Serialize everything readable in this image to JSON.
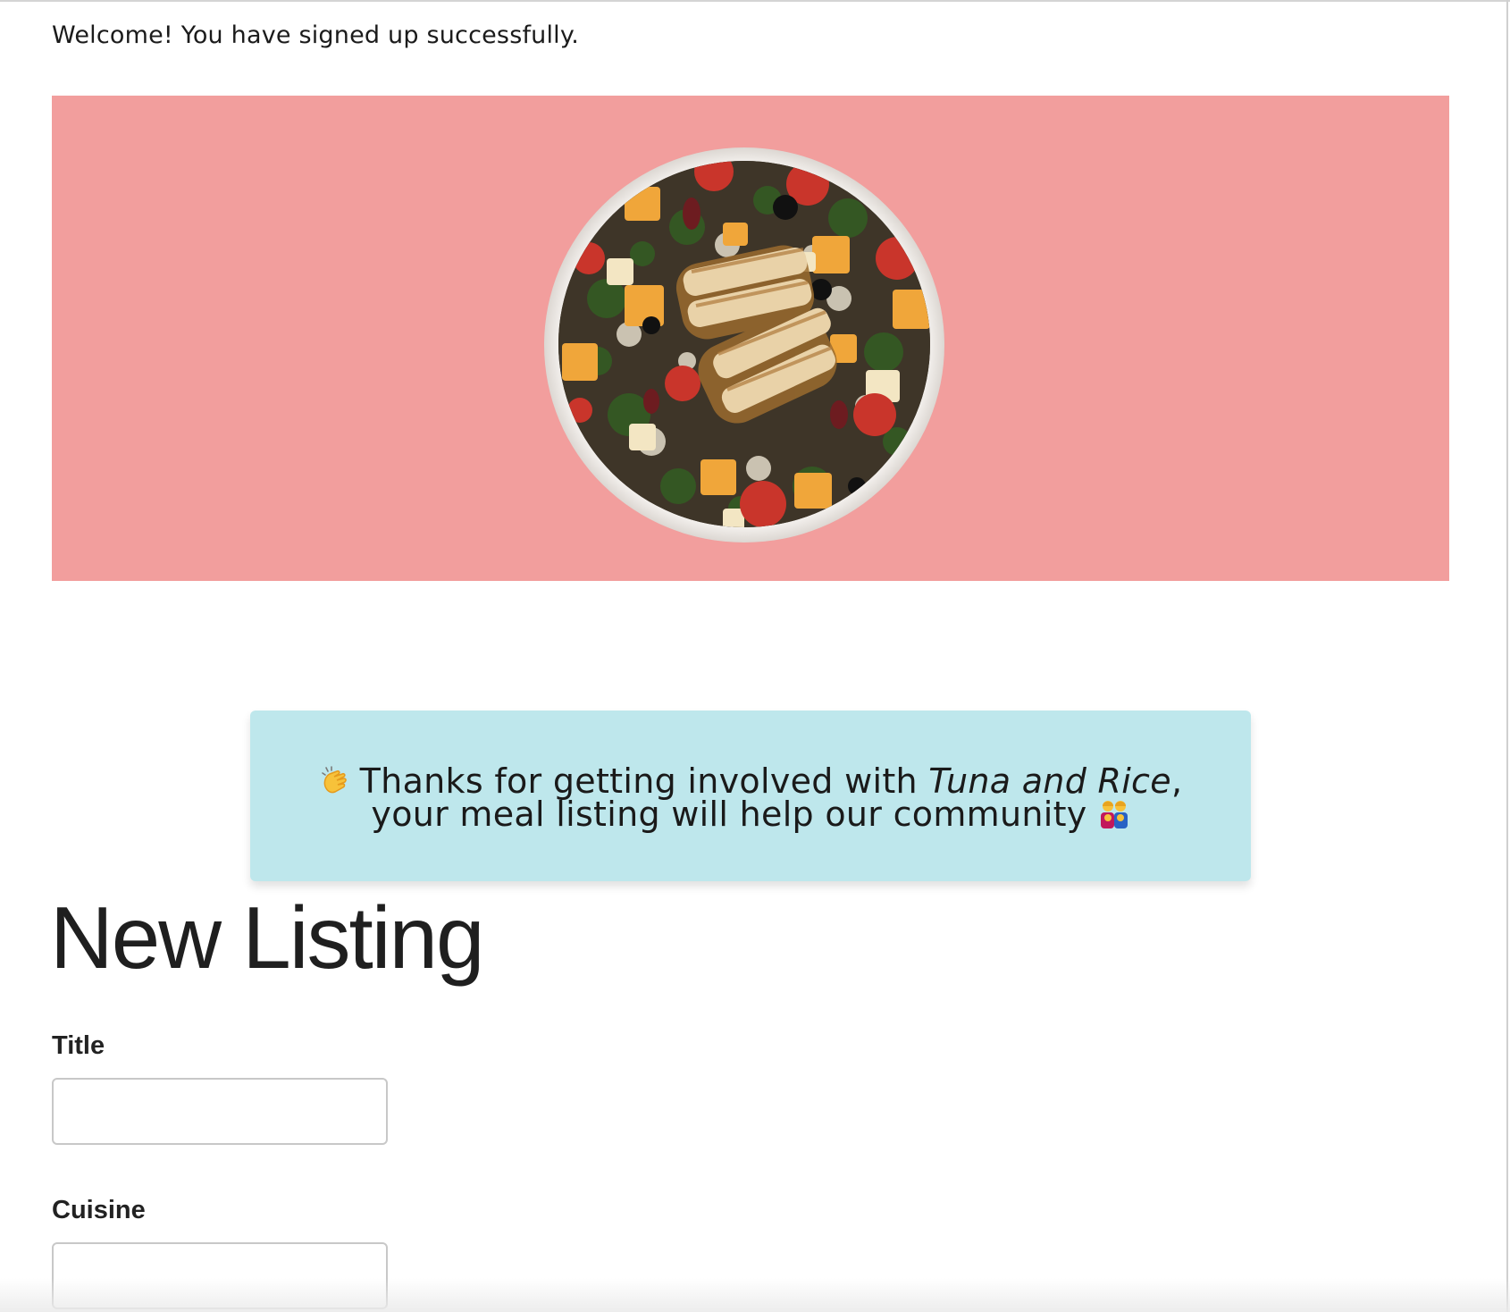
{
  "flash": {
    "message": "Welcome! You have signed up successfully."
  },
  "hero": {
    "background_color": "#f29e9d",
    "image": "salad-bowl-image"
  },
  "notice": {
    "background_color": "#bee7ec",
    "lead_icon": "clapping-hands-icon",
    "text_before": "Thanks for getting involved with ",
    "app_name": "Tuna and Rice",
    "text_after": ",",
    "line_two": "your meal listing will help our community",
    "trail_icon": "family-icon"
  },
  "page": {
    "title": "New Listing"
  },
  "form": {
    "title_label": "Title",
    "title_value": "",
    "cuisine_label": "Cuisine",
    "cuisine_value": ""
  }
}
